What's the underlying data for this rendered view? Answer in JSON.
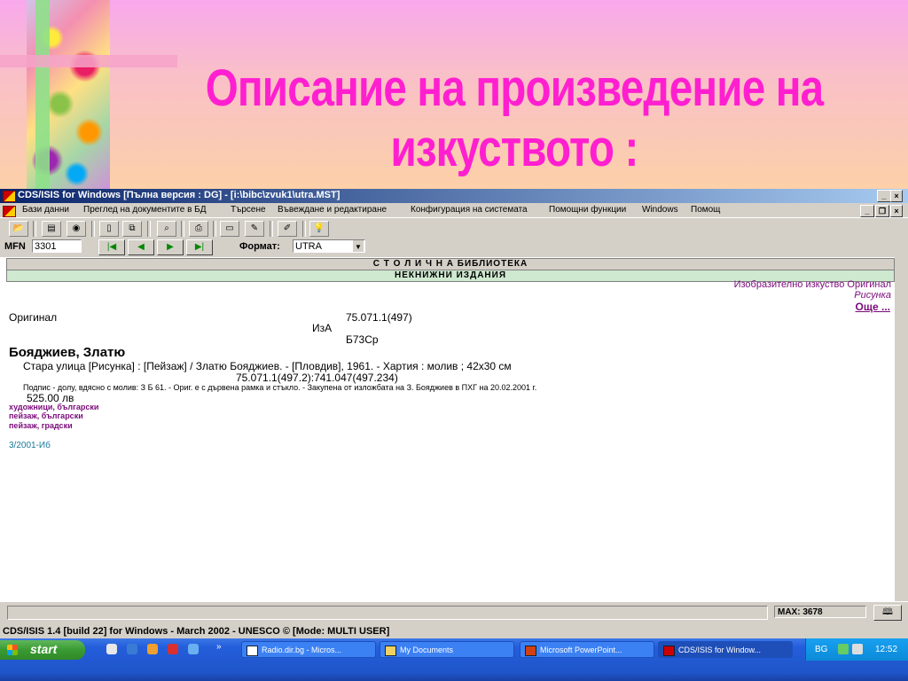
{
  "slide": {
    "title_line1": "Описание на произведение на",
    "title_line2": "изкуството :"
  },
  "window": {
    "title": "CDS/ISIS for Windows [Пълна версия : DG] - [i:\\bibc\\zvuk1\\utra.MST]"
  },
  "menu": {
    "items": [
      "Бази данни",
      "Преглед на документите в БД",
      "Търсене",
      "Въвеждане и редактиране",
      "Конфигурация на системата",
      "Помощни функции",
      "Windows",
      "Помощ"
    ]
  },
  "nav": {
    "mfn_label": "MFN",
    "mfn_value": "3301",
    "format_label": "Формат:",
    "format_value": "UTRA"
  },
  "record": {
    "library_header": "С Т О Л И Ч Н А  БИБЛИОТЕКА",
    "collection_header": "НЕКНИЖНИ  ИЗДАНИЯ",
    "top_right_line1": "Изобразително изкуство Оригинал",
    "top_right_line2": "Рисунка",
    "more_link": "Още ...",
    "original_label": "Оригинал",
    "class_number": "75.071.1(497)",
    "iza": "ИзА",
    "call_number": "Б73Ср",
    "author": "Бояджиев, Златю",
    "description": "Стара улица  [Рисунка] : [Пейзаж] / Златю Бояджиев. - [Пловдив], 1961. - Хартия : молив ; 42х30 см",
    "udc": "75.071.1(497.2):741.047(497.234)",
    "note": "Подпис - долу, вдясно с молив: З Б 61. - Ориг. е с дървена рамка и стъкло. - Закупена от изложбата на З. Бояджиев в ПХГ на 20.02.2001 г.",
    "price": "525.00 лв",
    "subjects": [
      "художници, български",
      "пейзаж, български",
      "пейзаж, градски"
    ],
    "inventory": "3/2001-Иб"
  },
  "status": {
    "max": "MAX: 3678",
    "version_line": "CDS/ISIS 1.4 [build 22] for Windows - March 2002 - UNESCO ©  [Mode: MULTI USER]"
  },
  "taskbar": {
    "start": "start",
    "tasks": [
      "Radio.dir.bg - Micros...",
      "My Documents",
      "Microsoft PowerPoint...",
      "CDS/ISIS for Window..."
    ],
    "lang": "BG",
    "clock": "12:52"
  },
  "colors": {
    "title_pink": "#ff1fd0",
    "link_purple": "#7a0a7a",
    "subject_purple": "#7a0a7a",
    "inventory_teal": "#1a7a9a",
    "xp_blue": "#245edb"
  }
}
